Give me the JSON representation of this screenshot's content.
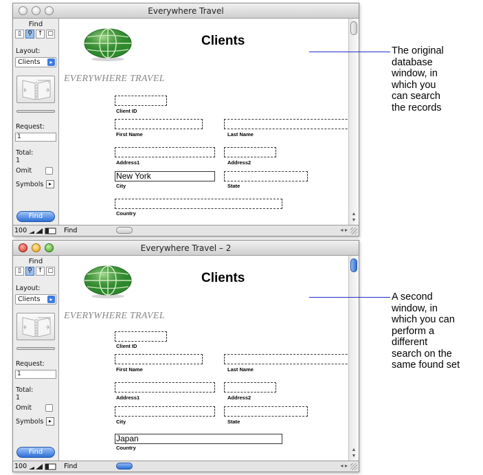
{
  "windows": [
    {
      "title": "Everywhere Travel",
      "status": {
        "find_label": "Find",
        "layout_label": "Layout:",
        "layout_value": "Clients",
        "request_label": "Request:",
        "request_value": "1",
        "total_label": "Total:",
        "total_value": "1",
        "omit_label": "Omit",
        "symbols_label": "Symbols",
        "find_button": "Find"
      },
      "layout": {
        "title": "Clients",
        "company": "EVERYWHERE TRAVEL",
        "fields": {
          "client_id": {
            "label": "Client ID",
            "value": ""
          },
          "first_name": {
            "label": "First Name",
            "value": ""
          },
          "last_name": {
            "label": "Last Name",
            "value": ""
          },
          "address1": {
            "label": "Address1",
            "value": ""
          },
          "address2": {
            "label": "Address2",
            "value": ""
          },
          "city": {
            "label": "City",
            "value": "New York"
          },
          "state": {
            "label": "State",
            "value": ""
          },
          "country": {
            "label": "Country",
            "value": ""
          }
        }
      },
      "bottom": {
        "zoom": "100",
        "mode": "Find"
      }
    },
    {
      "title": "Everywhere Travel – 2",
      "status": {
        "find_label": "Find",
        "layout_label": "Layout:",
        "layout_value": "Clients",
        "request_label": "Request:",
        "request_value": "1",
        "total_label": "Total:",
        "total_value": "1",
        "omit_label": "Omit",
        "symbols_label": "Symbols",
        "find_button": "Find"
      },
      "layout": {
        "title": "Clients",
        "company": "EVERYWHERE TRAVEL",
        "fields": {
          "client_id": {
            "label": "Client ID",
            "value": ""
          },
          "first_name": {
            "label": "First Name",
            "value": ""
          },
          "last_name": {
            "label": "Last Name",
            "value": ""
          },
          "address1": {
            "label": "Address1",
            "value": ""
          },
          "address2": {
            "label": "Address2",
            "value": ""
          },
          "city": {
            "label": "City",
            "value": ""
          },
          "state": {
            "label": "State",
            "value": ""
          },
          "country": {
            "label": "Country",
            "value": "Japan"
          }
        }
      },
      "bottom": {
        "zoom": "100",
        "mode": "Find"
      }
    }
  ],
  "callouts": [
    {
      "text": "The original\ndatabase\nwindow, in\nwhich you\ncan search\nthe records"
    },
    {
      "text": "A second\nwindow, in\nwhich you can\nperform a\ndifferent\nsearch on the\nsame found set"
    }
  ],
  "colors": {
    "callout_line": "#1d2bc8",
    "aqua_blue": "#2f6fd6",
    "close_red": "#d8261c"
  }
}
